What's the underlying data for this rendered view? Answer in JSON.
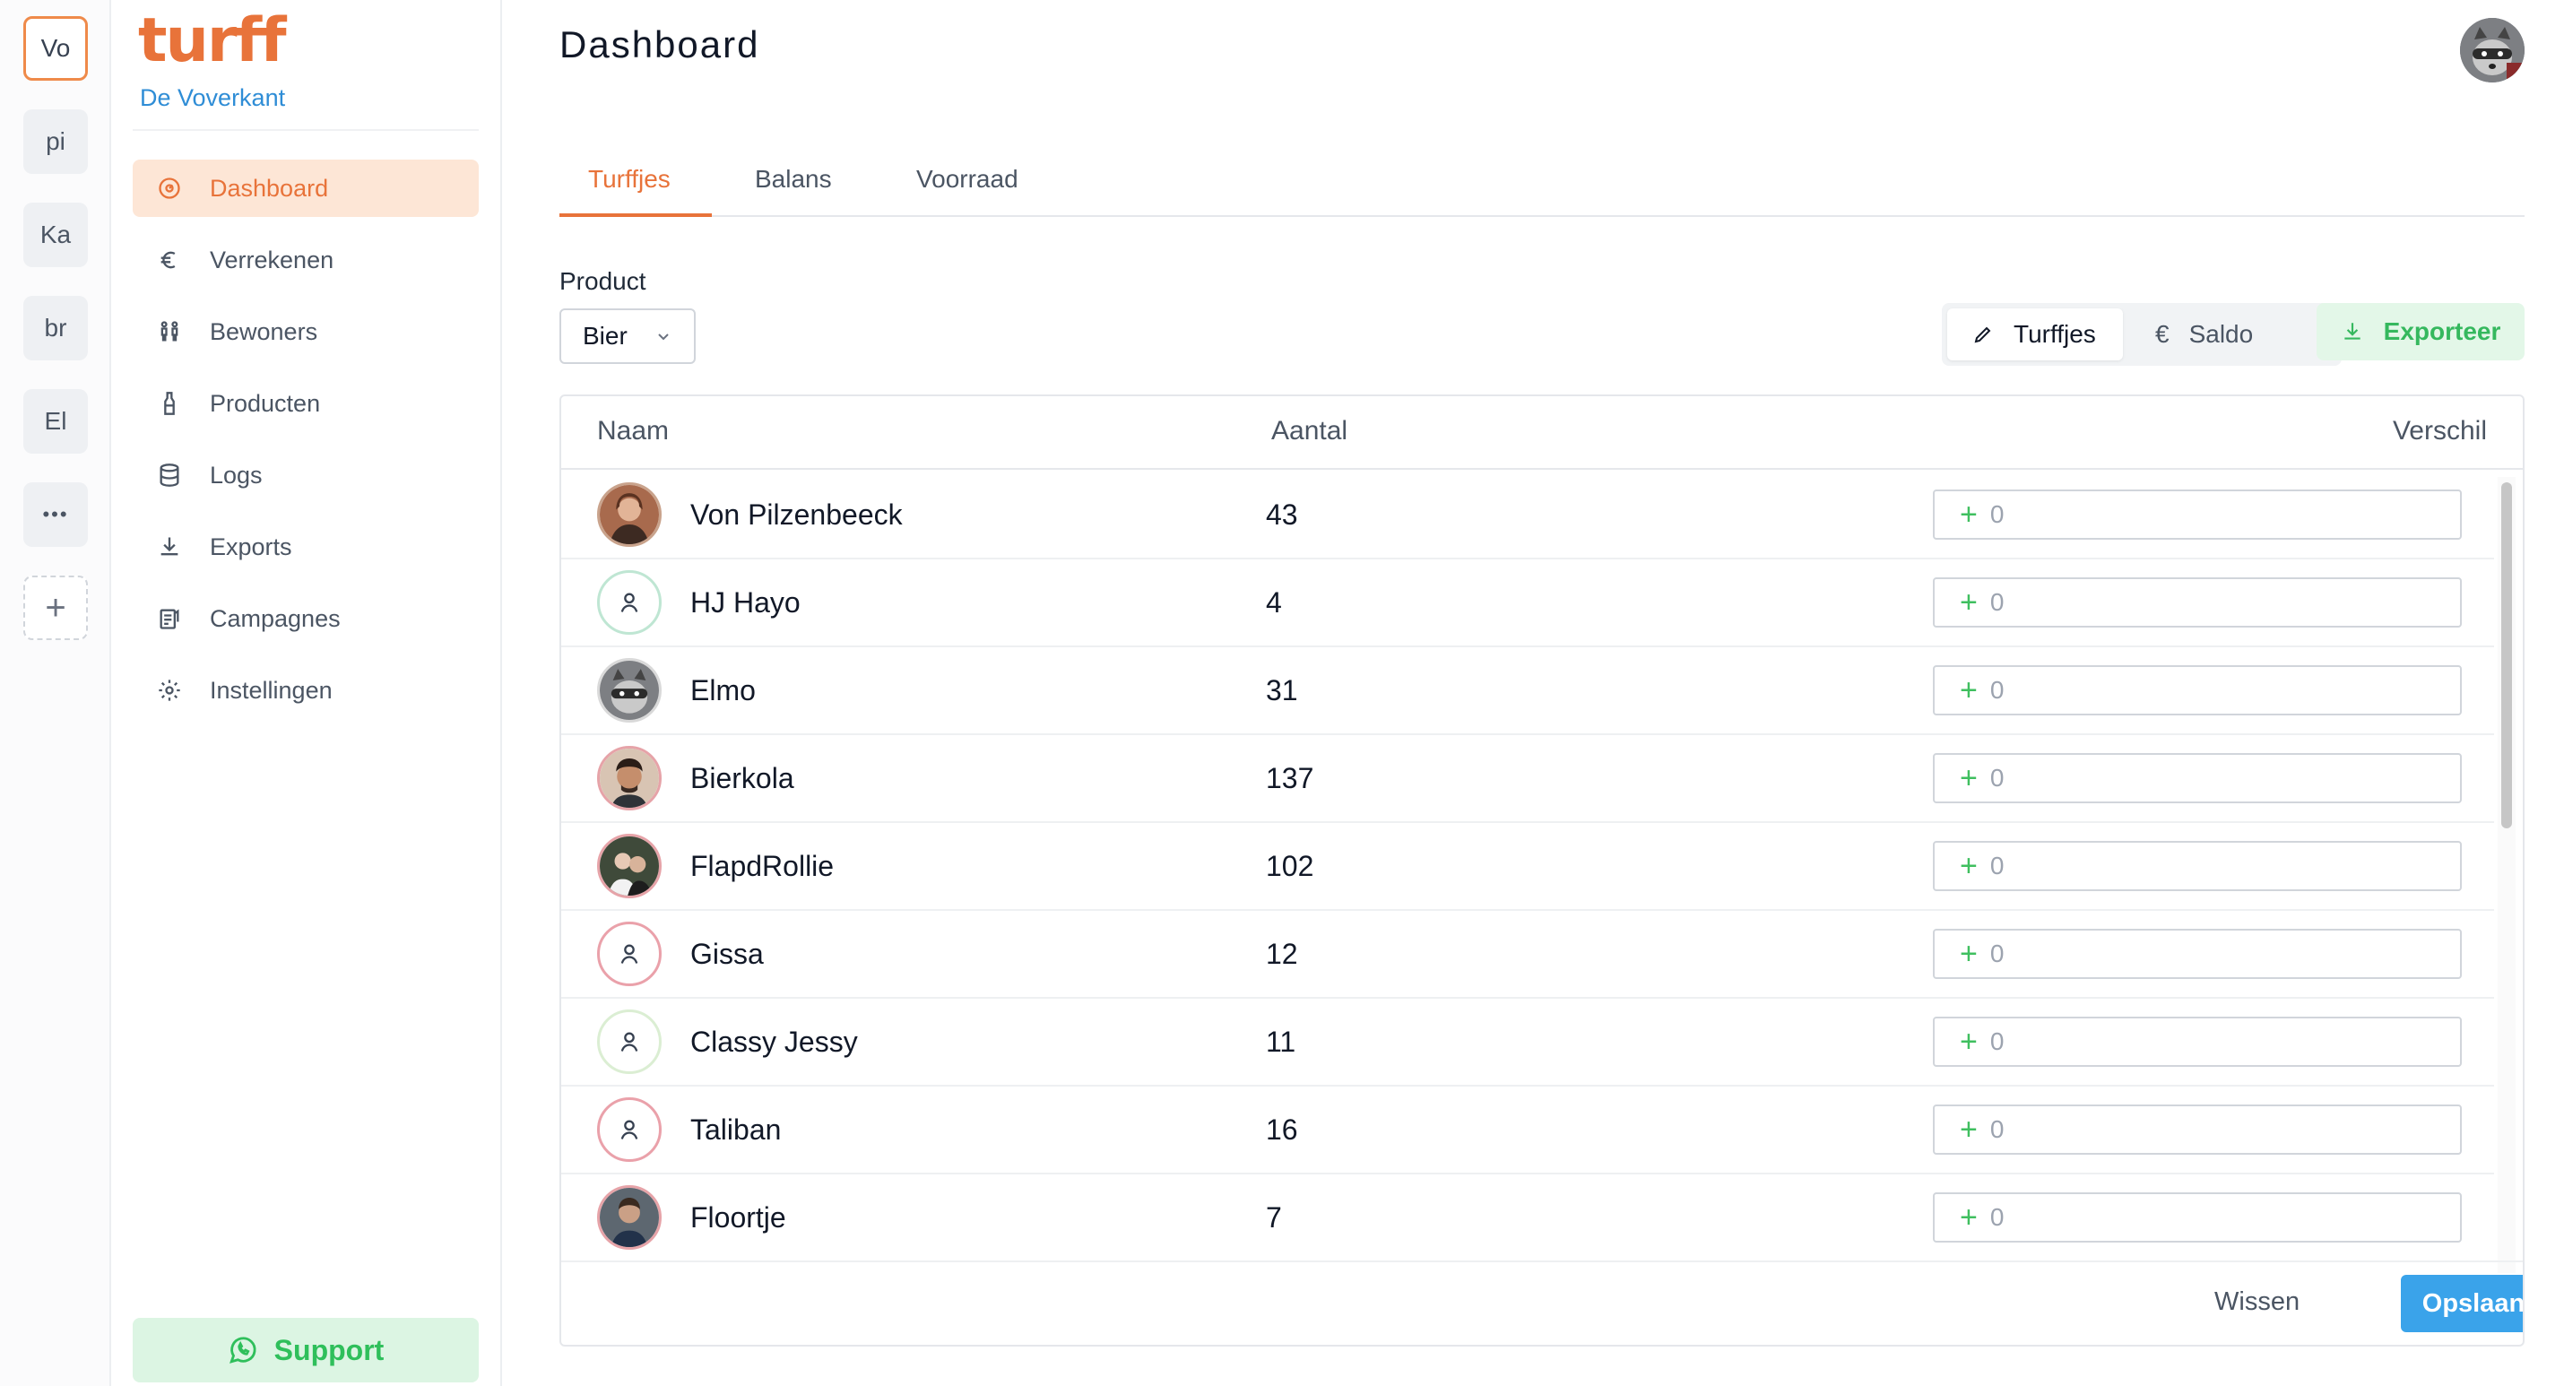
{
  "rail": {
    "accounts": [
      "Vo",
      "pi",
      "Ka",
      "br",
      "El"
    ],
    "more_label": "•••",
    "add_label": "+"
  },
  "sidebar": {
    "logo": "turff",
    "org_name": "De Voverkant",
    "items": [
      {
        "label": "Dashboard",
        "icon": "dashboard-icon"
      },
      {
        "label": "Verrekenen",
        "icon": "euro-icon"
      },
      {
        "label": "Bewoners",
        "icon": "users-icon"
      },
      {
        "label": "Producten",
        "icon": "bottle-icon"
      },
      {
        "label": "Logs",
        "icon": "database-icon"
      },
      {
        "label": "Exports",
        "icon": "download-icon"
      },
      {
        "label": "Campagnes",
        "icon": "campaign-icon"
      },
      {
        "label": "Instellingen",
        "icon": "gear-icon"
      }
    ],
    "support_label": "Support"
  },
  "header": {
    "title": "Dashboard"
  },
  "tabs": [
    "Turffjes",
    "Balans",
    "Voorraad"
  ],
  "filter": {
    "product_label": "Product",
    "product_value": "Bier"
  },
  "toggle": {
    "turffjes_label": "Turffjes",
    "saldo_label": "Saldo",
    "saldo_symbol": "€"
  },
  "export_label": "Exporteer",
  "table": {
    "columns": [
      "Naam",
      "Aantal",
      "Verschil"
    ],
    "rows": [
      {
        "name": "Von Pilzenbeeck",
        "count": "43",
        "diff": "0"
      },
      {
        "name": "HJ Hayo",
        "count": "4",
        "diff": "0"
      },
      {
        "name": "Elmo",
        "count": "31",
        "diff": "0"
      },
      {
        "name": "Bierkola",
        "count": "137",
        "diff": "0"
      },
      {
        "name": "FlapdRollie",
        "count": "102",
        "diff": "0"
      },
      {
        "name": "Gissa",
        "count": "12",
        "diff": "0"
      },
      {
        "name": "Classy Jessy",
        "count": "11",
        "diff": "0"
      },
      {
        "name": "Taliban",
        "count": "16",
        "diff": "0"
      },
      {
        "name": "Floortje",
        "count": "7",
        "diff": "0"
      }
    ]
  },
  "footer": {
    "clear_label": "Wissen",
    "save_label": "Opslaan"
  },
  "colors": {
    "brand": "#e8733a",
    "link": "#2f8dd6",
    "success": "#35b85e",
    "primary": "#3aa3ea"
  }
}
